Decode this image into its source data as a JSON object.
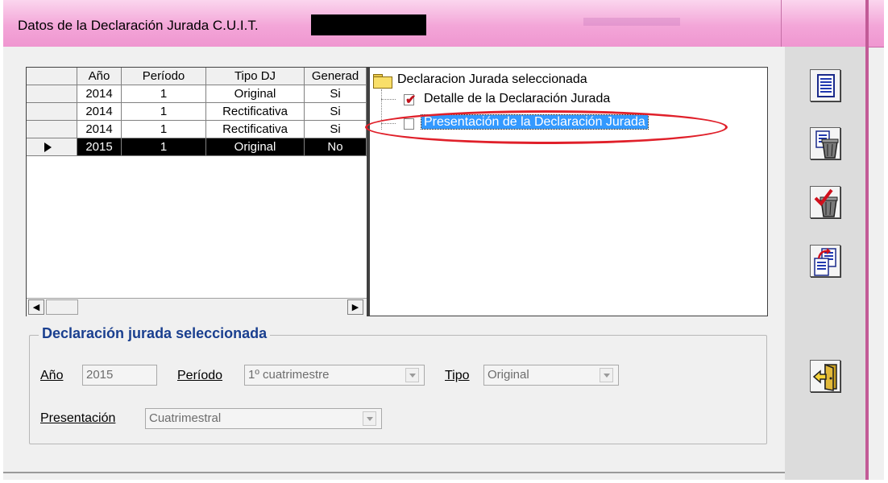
{
  "window": {
    "title": "Datos de la Declaración Jurada C.U.I.T."
  },
  "grid": {
    "columns": [
      "Año",
      "Período",
      "Tipo DJ",
      "Generad"
    ],
    "rows": [
      {
        "anio": "2014",
        "periodo": "1",
        "tipo": "Original",
        "generada": "Si"
      },
      {
        "anio": "2014",
        "periodo": "1",
        "tipo": "Rectificativa",
        "generada": "Si"
      },
      {
        "anio": "2014",
        "periodo": "1",
        "tipo": "Rectificativa",
        "generada": "Si"
      },
      {
        "anio": "2015",
        "periodo": "1",
        "tipo": "Original",
        "generada": "No"
      }
    ],
    "selected_row": 3
  },
  "tree": {
    "root": "Declaracion Jurada seleccionada",
    "items": [
      {
        "label": "Detalle de la Declaración Jurada",
        "checked": true
      },
      {
        "label": "Presentación de la Declaración Jurada",
        "checked": false,
        "selected": true
      }
    ]
  },
  "details": {
    "group_title": "Declaración jurada seleccionada",
    "anio_label": "Año",
    "anio_value": "2015",
    "periodo_label": "Período",
    "periodo_value": "1º cuatrimestre",
    "tipo_label": "Tipo",
    "tipo_value": "Original",
    "presentacion_label": "Presentación",
    "presentacion_value": "Cuatrimestral"
  },
  "side_buttons": [
    {
      "icon": "document-lines-icon"
    },
    {
      "icon": "trash-document-icon"
    },
    {
      "icon": "trash-check-icon"
    },
    {
      "icon": "copy-document-arrow-icon"
    },
    {
      "icon": "exit-door-icon"
    }
  ],
  "colors": {
    "title_bar": "#f3a6d8",
    "selection": "#3399ff",
    "highlight_ellipse": "#e0202a",
    "group_title": "#1a3f8f"
  }
}
